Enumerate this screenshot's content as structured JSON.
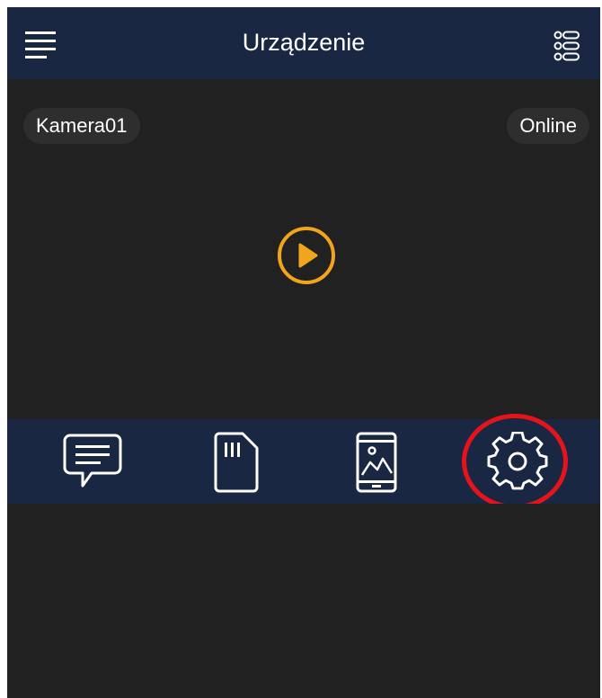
{
  "header": {
    "title": "Urządzenie",
    "menu_icon": "hamburger-menu-icon",
    "list_icon": "device-list-icon"
  },
  "live_view": {
    "camera_name": "Kamera01",
    "status": "Online",
    "play_icon": "play-icon",
    "accent_color": "#f2a41c"
  },
  "actions": [
    {
      "name": "messages",
      "icon": "message-icon"
    },
    {
      "name": "sd-card",
      "icon": "sd-card-icon"
    },
    {
      "name": "phone-gallery",
      "icon": "phone-image-icon"
    },
    {
      "name": "settings",
      "icon": "gear-icon",
      "highlighted": true
    }
  ],
  "colors": {
    "bar_background": "#1a2742",
    "screen_background": "#212121",
    "highlight": "#e5141b"
  }
}
